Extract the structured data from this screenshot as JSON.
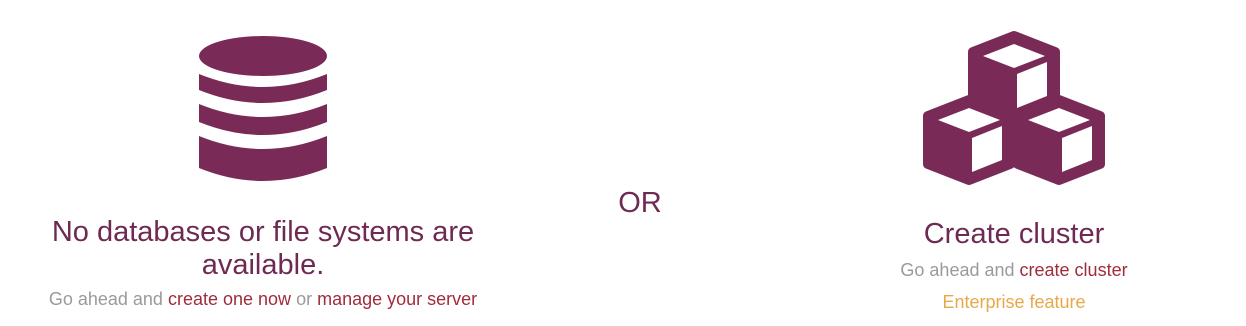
{
  "colors": {
    "brand": "#7a2a56",
    "link": "#a02c3c",
    "muted": "#9a9a9a",
    "enterprise": "#e8a84a"
  },
  "left": {
    "icon": "database-icon",
    "title": "No databases or file systems are available.",
    "sub_prefix": "Go ahead and",
    "create_link": "create one now",
    "or_word": "or",
    "manage_link": "manage your server"
  },
  "separator": {
    "label": "OR"
  },
  "right": {
    "icon": "cubes-icon",
    "title": "Create cluster",
    "sub_prefix": "Go ahead and",
    "create_link": "create cluster",
    "enterprise_label": "Enterprise feature"
  }
}
